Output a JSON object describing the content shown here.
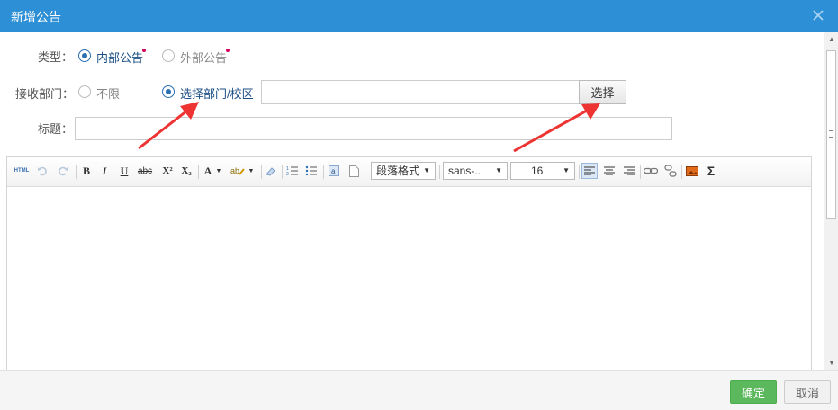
{
  "dialog": {
    "title": "新增公告",
    "close_icon": "close-icon"
  },
  "form": {
    "type": {
      "label": "类型：",
      "options": [
        {
          "label": "内部公告",
          "checked": true
        },
        {
          "label": "外部公告",
          "checked": false
        }
      ]
    },
    "recipients": {
      "label": "接收部门：",
      "options": [
        {
          "label": "不限",
          "checked": false
        },
        {
          "label": "选择部门/校区",
          "checked": true
        }
      ],
      "input_value": "",
      "select_button": "选择"
    },
    "title_field": {
      "label": "标题：",
      "value": ""
    }
  },
  "editor": {
    "toolbar": {
      "html": "HTML",
      "bold": "B",
      "italic": "I",
      "underline": "U",
      "strike": "abc",
      "superscript": "X²",
      "subscript": "X₂",
      "font_color": "A",
      "paragraph_format": "段落格式",
      "font_family": "sans-...",
      "font_size": "16",
      "formula": "Σ"
    },
    "body": ""
  },
  "footer": {
    "ok": "确定",
    "cancel": "取消"
  },
  "colors": {
    "titlebar": "#2d8fd5",
    "ok_button": "#5cb85c",
    "annotation_arrow": "#ee3333",
    "required_dot": "#d6005f"
  }
}
